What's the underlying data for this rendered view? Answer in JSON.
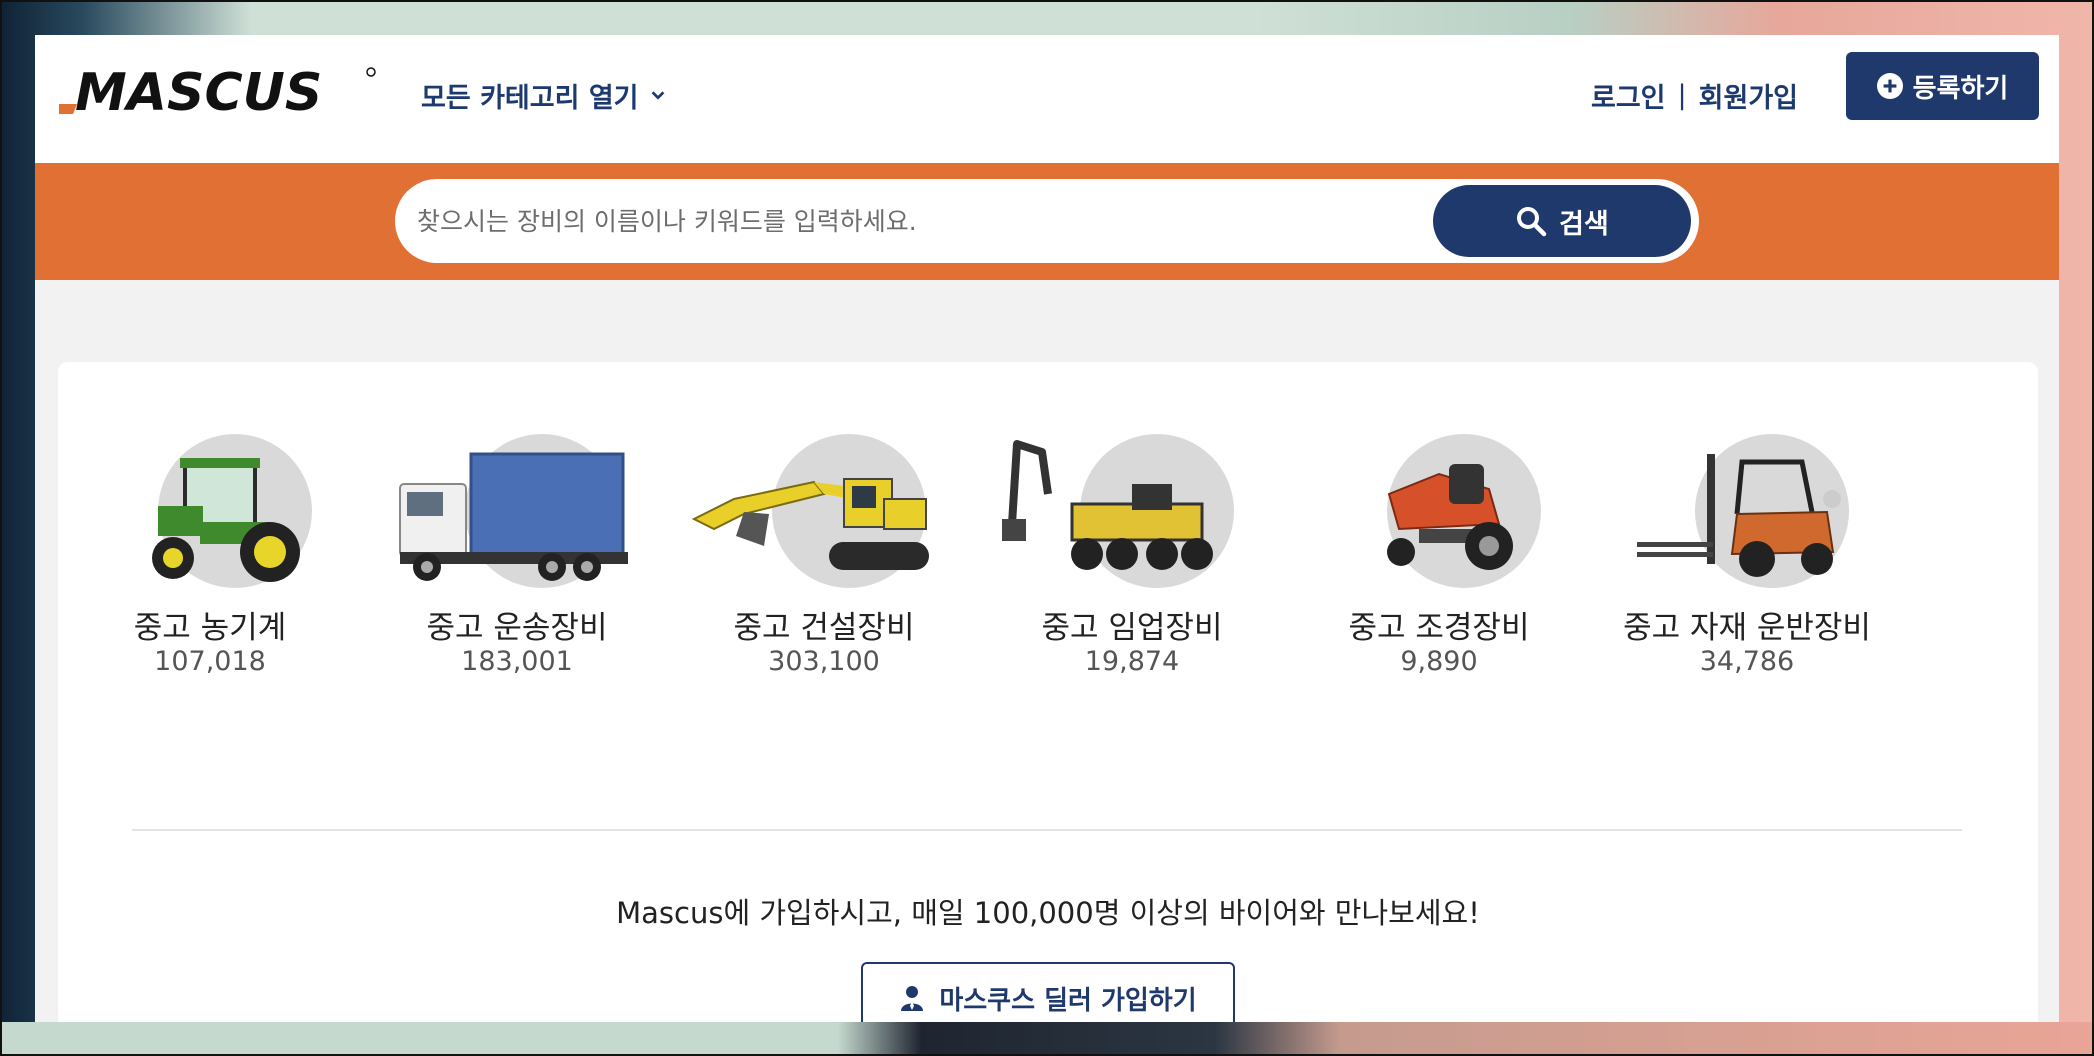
{
  "header": {
    "brand": "MASCUS",
    "categories_label": "모든 카테고리 열기",
    "login_label": "로그인",
    "separator": "|",
    "signup_label": "회원가입",
    "register_label": "등록하기"
  },
  "search": {
    "placeholder": "찾으시는 장비의 이름이나 키워드를 입력하세요.",
    "button_label": "검색"
  },
  "categories": [
    {
      "name": "중고 농기계",
      "count": "107,018",
      "icon": "tractor-icon"
    },
    {
      "name": "중고 운송장비",
      "count": "183,001",
      "icon": "truck-icon"
    },
    {
      "name": "중고 건설장비",
      "count": "303,100",
      "icon": "excavator-icon"
    },
    {
      "name": "중고 임업장비",
      "count": "19,874",
      "icon": "harvester-icon"
    },
    {
      "name": "중고 조경장비",
      "count": "9,890",
      "icon": "lawn-mower-icon"
    },
    {
      "name": "중고 자재 운반장비",
      "count": "34,786",
      "icon": "forklift-icon"
    }
  ],
  "promo": {
    "text": "Mascus에 가입하시고, 매일 100,000명 이상의 바이어와 만나보세요!",
    "dealer_button_label": "마스쿠스 딜러 가입하기"
  },
  "colors": {
    "navy": "#20396d",
    "orange": "#e17035",
    "tractor_green": "#3f8a2c",
    "excavator_yellow": "#e8cf2a",
    "mower_orange": "#d6502a"
  }
}
